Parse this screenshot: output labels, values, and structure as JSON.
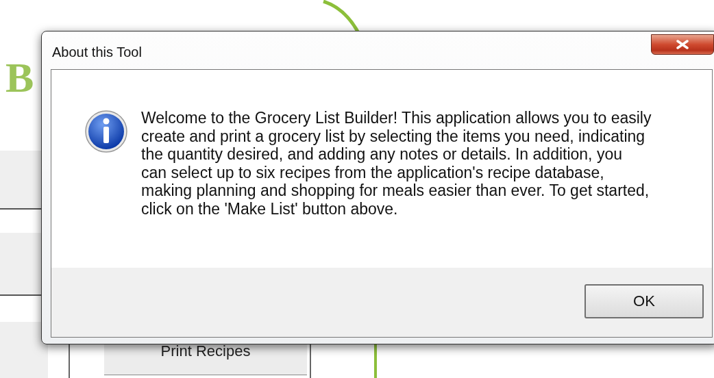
{
  "background": {
    "logo_letter": "B",
    "button": "Print Recipes"
  },
  "dialog": {
    "title": "About this Tool",
    "message": "Welcome to the Grocery List Builder! This application allows you to easily create and print a grocery list by selecting the items you need, indicating the quantity desired, and adding any notes or details. In addition, you can select up to six recipes from the application's recipe database, making planning and shopping for meals easier than ever. To get started, click on the 'Make List' button above.",
    "buttons": [
      "OK"
    ]
  }
}
